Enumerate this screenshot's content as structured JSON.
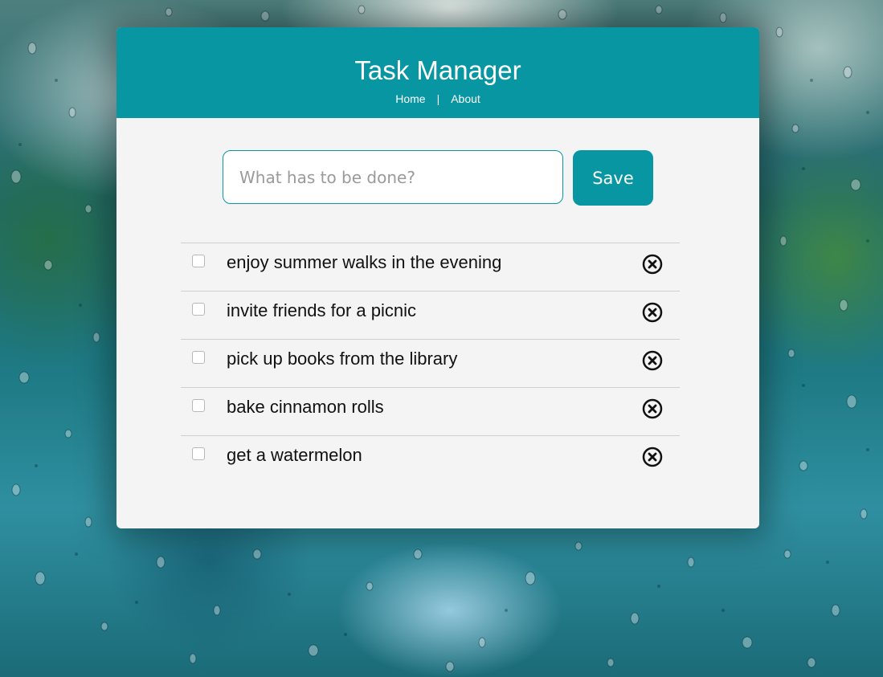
{
  "header": {
    "title": "Task Manager",
    "nav": [
      {
        "label": "Home"
      },
      {
        "label": "About"
      }
    ],
    "nav_separator": "|"
  },
  "form": {
    "placeholder": "What has to be done?",
    "value": "",
    "save_label": "Save"
  },
  "tasks": [
    {
      "text": "enjoy summer walks in the evening",
      "done": false
    },
    {
      "text": "invite friends for a picnic",
      "done": false
    },
    {
      "text": "pick up books from the library",
      "done": false
    },
    {
      "text": "bake cinnamon rolls",
      "done": false
    },
    {
      "text": "get a watermelon",
      "done": false
    }
  ],
  "icons": {
    "delete": "close-circle-icon",
    "checkbox": "checkbox-icon"
  },
  "colors": {
    "accent": "#0896a3",
    "card_background": "#f4f4f4",
    "text": "#111111"
  }
}
